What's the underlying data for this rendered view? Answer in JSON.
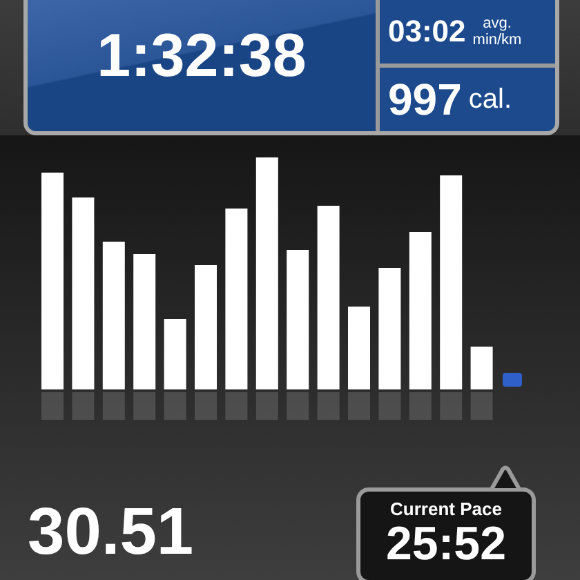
{
  "duration": "1:32:38",
  "pace": {
    "value": "03:02",
    "label_top": "avg.",
    "label_bottom": "min/km"
  },
  "calories": {
    "value": "997",
    "unit": "cal."
  },
  "distance": "30.51",
  "current_pace": {
    "label": "Current Pace",
    "value": "25:52"
  }
}
